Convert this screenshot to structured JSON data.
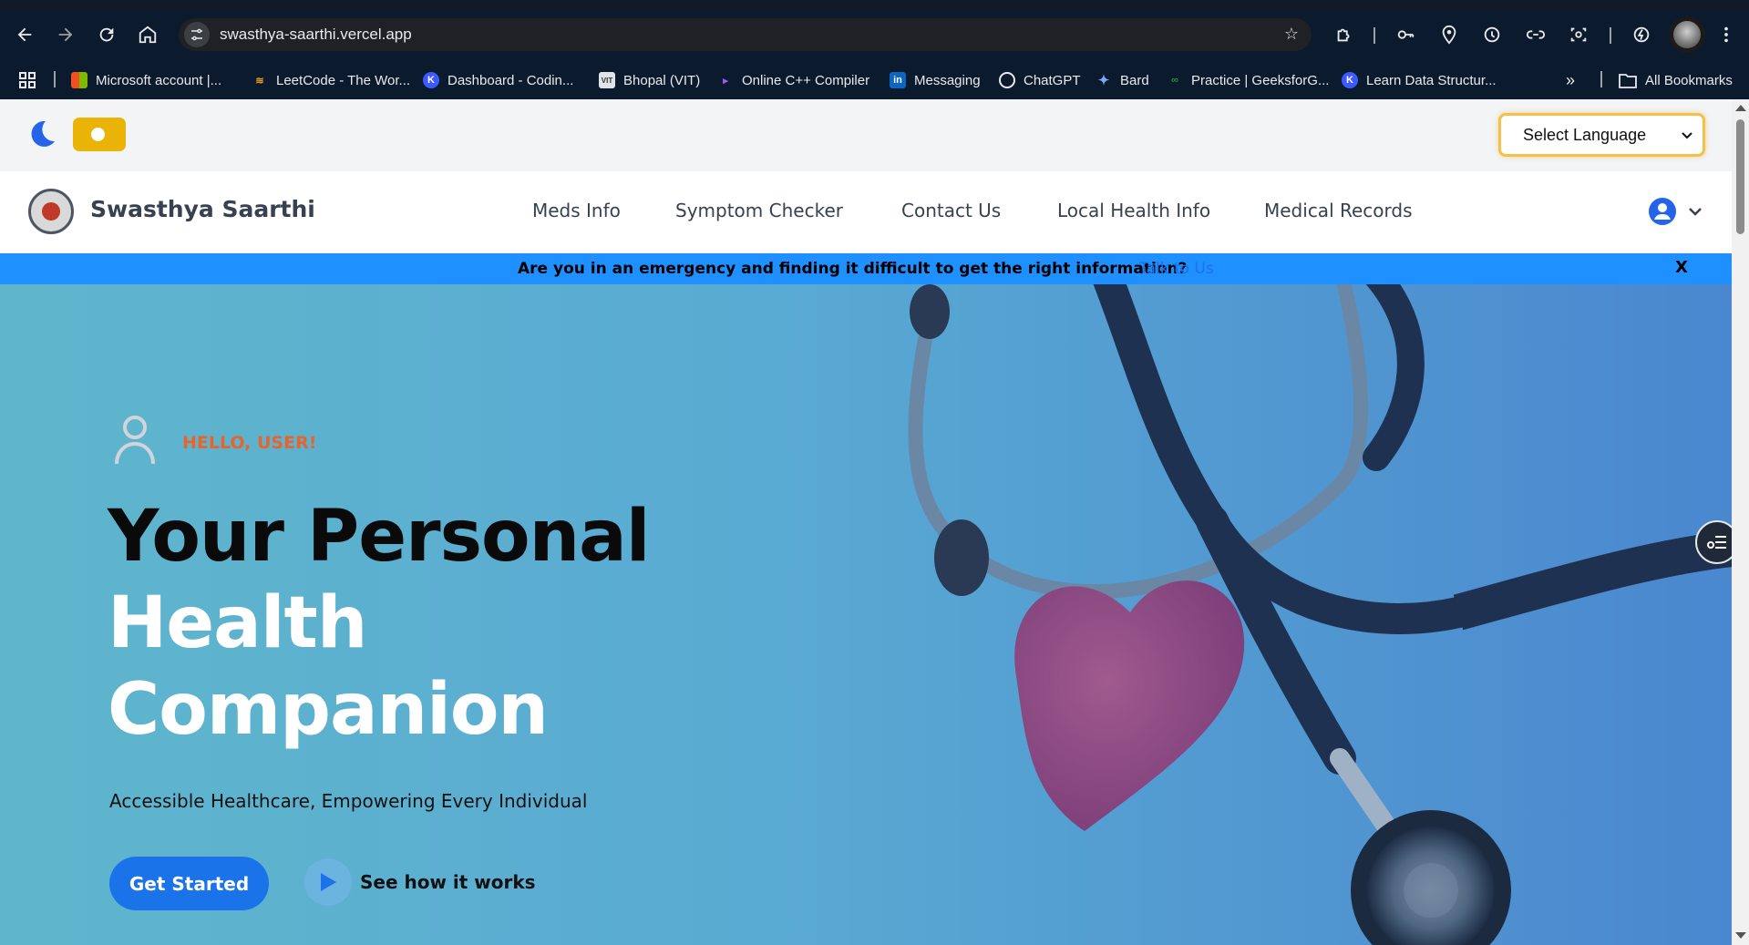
{
  "browser": {
    "url": "swasthya-saarthi.vercel.app",
    "bookmarks": [
      {
        "label": "Microsoft account |...",
        "icon": "microsoft-icon"
      },
      {
        "label": "LeetCode - The Wor...",
        "icon": "leetcode-icon"
      },
      {
        "label": "Dashboard - Codin...",
        "icon": "coding-ninjas-icon"
      },
      {
        "label": "Bhopal (VIT)",
        "icon": "vit-icon"
      },
      {
        "label": "Online C++ Compiler",
        "icon": "compiler-icon"
      },
      {
        "label": "Messaging",
        "icon": "linkedin-icon"
      },
      {
        "label": "ChatGPT",
        "icon": "chatgpt-icon"
      },
      {
        "label": "Bard",
        "icon": "bard-icon"
      },
      {
        "label": "Practice | GeeksforG...",
        "icon": "geeksforgeeks-icon"
      },
      {
        "label": "Learn Data Structur...",
        "icon": "coding-ninjas-icon"
      }
    ],
    "all_bookmarks": "All Bookmarks"
  },
  "utility": {
    "language_select": "Select Language"
  },
  "nav": {
    "brand": "Swasthya Saarthi",
    "links": [
      "Meds Info",
      "Symptom Checker",
      "Contact Us",
      "Local Health Info",
      "Medical Records"
    ]
  },
  "banner": {
    "text": "Are you in an emergency and finding it difficult to get the right information?",
    "link": "Talk to Us",
    "close": "X"
  },
  "hero": {
    "greeting": "HELLO, USER!",
    "headline_line1": "Your Personal",
    "headline_line2": "Health",
    "headline_line3": "Companion",
    "subtitle": "Accessible Healthcare, Empowering Every Individual",
    "primary_button": "Get Started",
    "secondary_button": "See how it works"
  },
  "colors": {
    "accent_blue": "#1a73e8",
    "banner_blue": "#1e90ff",
    "greeting_orange": "#e8642b",
    "toggle_yellow": "#eab308"
  }
}
